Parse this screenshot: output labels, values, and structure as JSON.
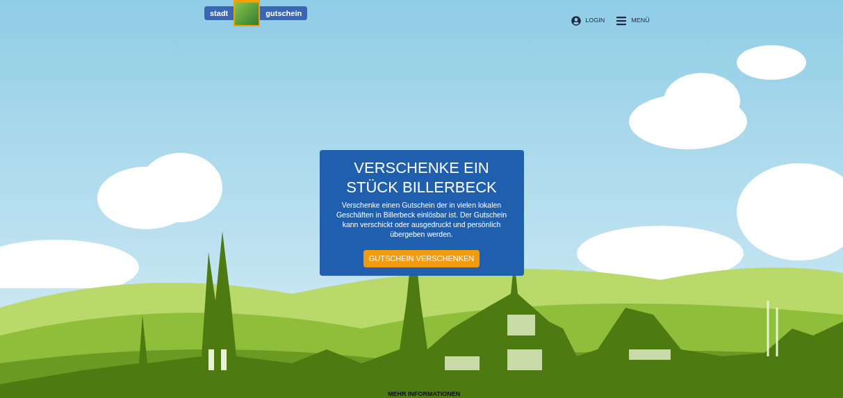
{
  "header": {
    "logo": {
      "left": "stadt",
      "right": "gutschein"
    },
    "nav": [
      {
        "kind": "login",
        "label": "LOGIN"
      },
      {
        "kind": "menu",
        "label": "MENÜ"
      }
    ]
  },
  "hero": {
    "title_lines": [
      "VERSCHENKE EIN",
      "STÜCK BILLERBECK"
    ],
    "text": "Verschenke einen Gutschein der in vielen lokalen Geschäften in Billerbeck einlösbar ist. Der Gutschein kann verschickt oder ausgedruckt und persönlich übergeben werden.",
    "button": "GUTSCHEIN VERSCHENKEN"
  },
  "more_link": "MEHR INFORMATIONEN"
}
